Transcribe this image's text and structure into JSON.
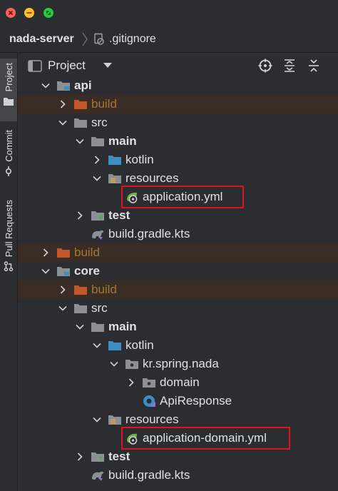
{
  "window": {
    "project_name": "nada-server",
    "current_file": ".gitignore"
  },
  "side_stripe": {
    "tabs": [
      {
        "label": "Project"
      },
      {
        "label": "Commit"
      },
      {
        "label": "Pull Requests"
      }
    ]
  },
  "project_panel": {
    "title": "Project"
  },
  "tree": [
    {
      "label": "api"
    },
    {
      "label": "build"
    },
    {
      "label": "src"
    },
    {
      "label": "main"
    },
    {
      "label": "kotlin"
    },
    {
      "label": "resources"
    },
    {
      "label": "application.yml"
    },
    {
      "label": "test"
    },
    {
      "label": "build.gradle.kts"
    },
    {
      "label": "build"
    },
    {
      "label": "core"
    },
    {
      "label": "build"
    },
    {
      "label": "src"
    },
    {
      "label": "main"
    },
    {
      "label": "kotlin"
    },
    {
      "label": "kr.spring.nada"
    },
    {
      "label": "domain"
    },
    {
      "label": "ApiResponse"
    },
    {
      "label": "resources"
    },
    {
      "label": "application-domain.yml"
    },
    {
      "label": "test"
    },
    {
      "label": "build.gradle.kts"
    }
  ],
  "colors": {
    "background": "#2b2d30",
    "excluded_row": "#3a2d26",
    "excluded_text": "#a6762e",
    "folder": "#8c9096",
    "source_folder": "#3d8fbf",
    "highlight_box": "#e0141e"
  }
}
